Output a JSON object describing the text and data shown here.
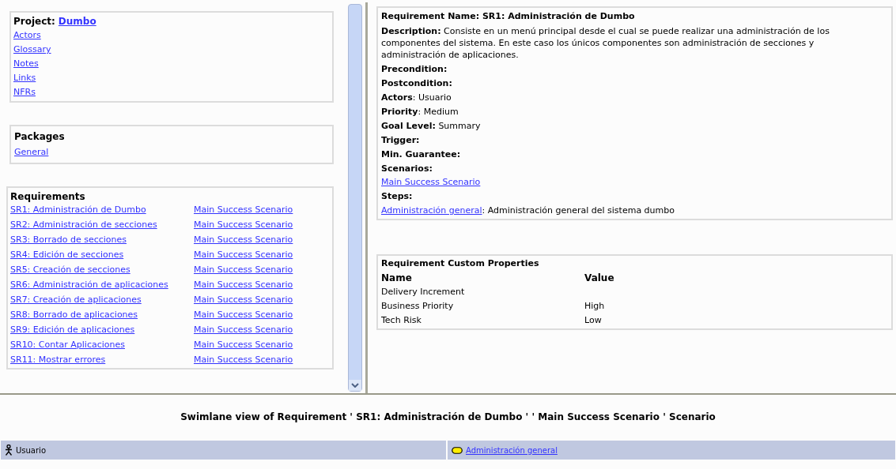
{
  "project": {
    "label": "Project:",
    "name": "Dumbo",
    "links": [
      "Actors",
      "Glossary",
      "Notes",
      "Links",
      "NFRs"
    ]
  },
  "packages": {
    "title": "Packages",
    "items": [
      "General"
    ]
  },
  "requirements": {
    "title": "Requirements",
    "rows": [
      {
        "name": "SR1: Administración de Dumbo",
        "scenario": "Main Success Scenario"
      },
      {
        "name": "SR2: Administración de secciones",
        "scenario": "Main Success Scenario"
      },
      {
        "name": "SR3: Borrado de secciones",
        "scenario": "Main Success Scenario"
      },
      {
        "name": "SR4: Edición de secciones",
        "scenario": "Main Success Scenario"
      },
      {
        "name": "SR5: Creación de secciones",
        "scenario": "Main Success Scenario"
      },
      {
        "name": "SR6: Administración de aplicaciones",
        "scenario": "Main Success Scenario"
      },
      {
        "name": "SR7: Creación de aplicaciones",
        "scenario": "Main Success Scenario"
      },
      {
        "name": "SR8: Borrado de aplicaciones",
        "scenario": "Main Success Scenario"
      },
      {
        "name": "SR9: Edición de aplicaciones",
        "scenario": "Main Success Scenario"
      },
      {
        "name": "SR10: Contar Aplicaciones",
        "scenario": "Main Success Scenario"
      },
      {
        "name": "SR11: Mostrar errores",
        "scenario": "Main Success Scenario"
      }
    ]
  },
  "detail": {
    "title": "Requirement Name: SR1: Administración de Dumbo",
    "fields": [
      {
        "label": "Description:",
        "value": " Consiste en un menú principal desde el cual se puede realizar una administración de los componentes del sistema. En este caso los únicos componentes son administración de secciones y administración de aplicaciones."
      },
      {
        "label": "Precondition:"
      },
      {
        "label": "Postcondition:"
      },
      {
        "label": "Actors",
        "value": ": Usuario"
      },
      {
        "label": "Priority",
        "value": ": Medium"
      },
      {
        "label": "Goal Level:",
        "value": " Summary"
      },
      {
        "label": "Trigger:"
      },
      {
        "label": "Min. Guarantee:"
      },
      {
        "label": "Scenarios:"
      }
    ],
    "scenarios": [
      "Main Success Scenario"
    ],
    "steps_label": "Steps:",
    "steps": [
      {
        "link": "Administración general ",
        "text": ": Administración general del sistema dumbo"
      }
    ]
  },
  "custom_properties": {
    "title": "Requirement Custom Properties",
    "columns": [
      "Name",
      "Value"
    ],
    "rows": [
      {
        "name": "Delivery Increment"
      },
      {
        "name": "Business Priority",
        "value": "High"
      },
      {
        "name": "Tech Risk",
        "value": "Low"
      }
    ]
  },
  "swimlane": {
    "title": "Swimlane view of Requirement ' SR1: Administración de Dumbo ' ' Main Success Scenario ' Scenario",
    "lanes": [
      {
        "kind": "actor",
        "label": "Usuario"
      },
      {
        "kind": "step",
        "label": "Administración general"
      }
    ]
  }
}
